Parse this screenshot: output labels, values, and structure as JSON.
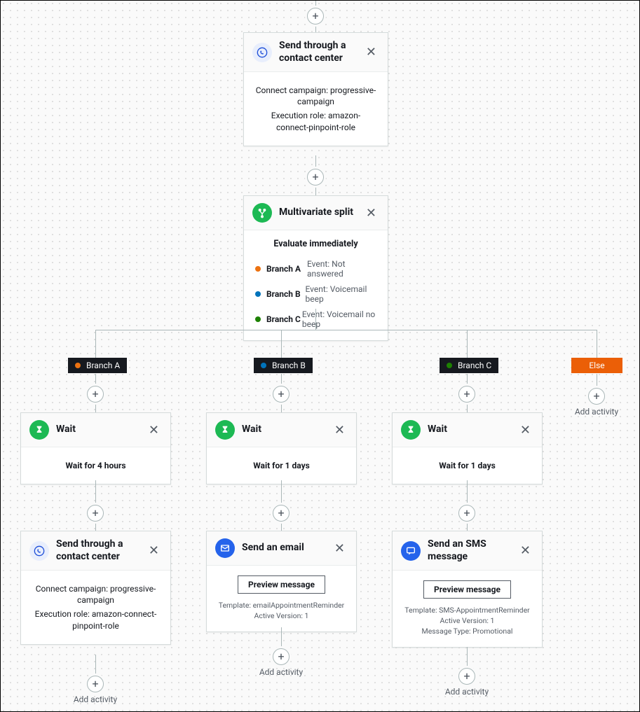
{
  "nodes": {
    "contact1": {
      "title": "Send through a contact center",
      "campaign": "Connect campaign: progressive-campaign",
      "role": "Execution role: amazon-connect-pinpoint-role"
    },
    "split": {
      "title": "Multivariate split",
      "subtitle": "Evaluate immediately",
      "branches": [
        {
          "name": "Branch A",
          "event": "Event: Not answered"
        },
        {
          "name": "Branch B",
          "event": "Event: Voicemail beep"
        },
        {
          "name": "Branch C",
          "event": "Event: Voicemail no beep"
        }
      ]
    },
    "pills": {
      "a": "Branch A",
      "b": "Branch B",
      "c": "Branch C",
      "else": "Else"
    },
    "waitA": {
      "title": "Wait",
      "body": "Wait for 4 hours"
    },
    "waitB": {
      "title": "Wait",
      "body": "Wait for 1 days"
    },
    "waitC": {
      "title": "Wait",
      "body": "Wait for 1 days"
    },
    "contact2": {
      "title": "Send through a contact center",
      "campaign": "Connect campaign: progressive-campaign",
      "role": "Execution role: amazon-connect-pinpoint-role"
    },
    "email": {
      "title": "Send an email",
      "preview": "Preview message",
      "template": "Template: emailAppointmentReminder",
      "version": "Active Version: 1"
    },
    "sms": {
      "title": "Send an SMS message",
      "preview": "Preview message",
      "template": "Template: SMS-AppointmentReminder",
      "version": "Active Version: 1",
      "msgtype": "Message Type: Promotional"
    },
    "addActivity": "Add activity"
  }
}
